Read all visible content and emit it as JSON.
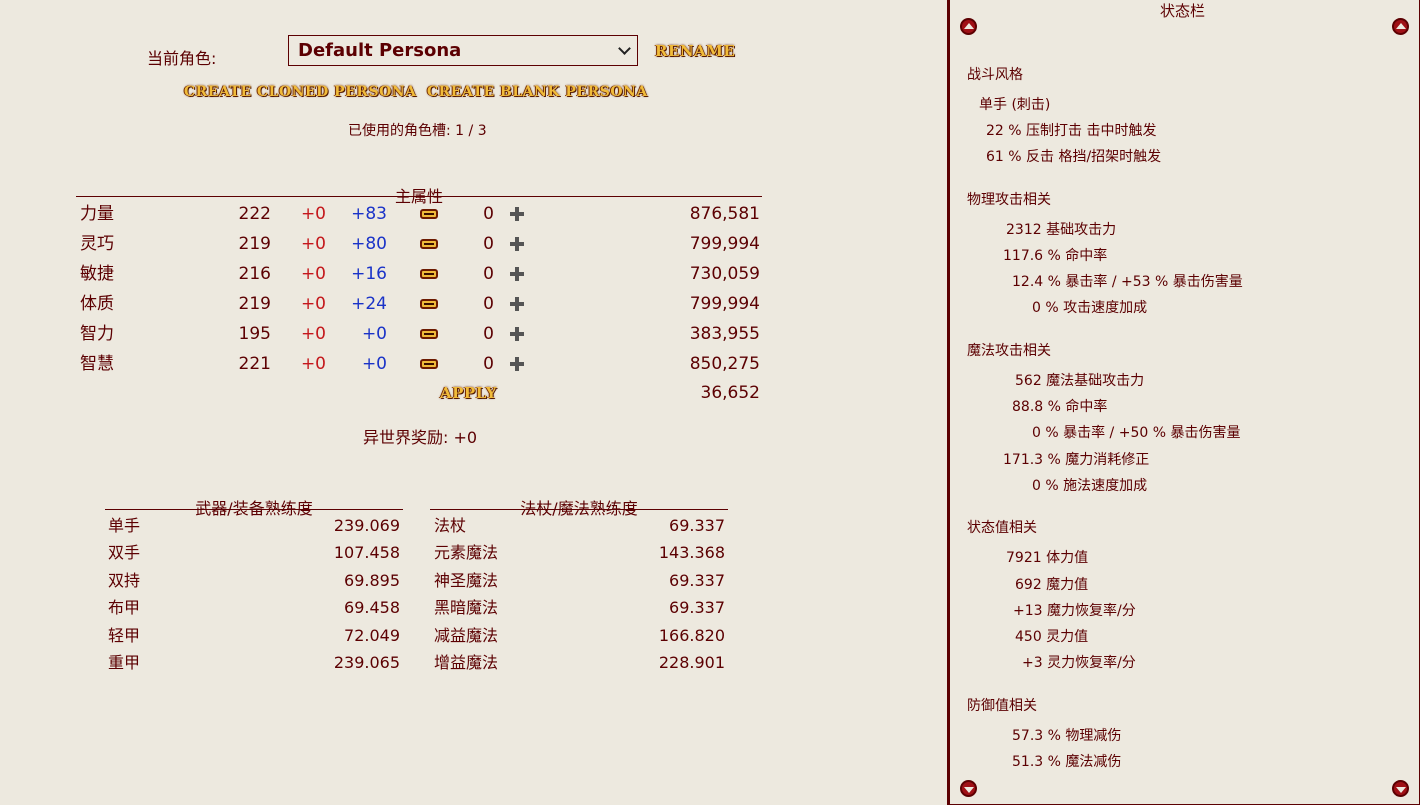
{
  "persona": {
    "label": "当前角色:",
    "selected": "Default Persona",
    "rename_label": "RENAME",
    "clone_label": "CREATE CLONED PERSONA",
    "blank_label": "CREATE BLANK PERSONA",
    "slots_text": "已使用的角色槽: 1 / 3"
  },
  "attributes": {
    "title": "主属性",
    "rows": [
      {
        "name": "力量",
        "base": "222",
        "mod": "+0",
        "bonus": "+83",
        "spent": "0",
        "cost": "876,581"
      },
      {
        "name": "灵巧",
        "base": "219",
        "mod": "+0",
        "bonus": "+80",
        "spent": "0",
        "cost": "799,994"
      },
      {
        "name": "敏捷",
        "base": "216",
        "mod": "+0",
        "bonus": "+16",
        "spent": "0",
        "cost": "730,059"
      },
      {
        "name": "体质",
        "base": "219",
        "mod": "+0",
        "bonus": "+24",
        "spent": "0",
        "cost": "799,994"
      },
      {
        "name": "智力",
        "base": "195",
        "mod": "+0",
        "bonus": "+0",
        "spent": "0",
        "cost": "383,955"
      },
      {
        "name": "智慧",
        "base": "221",
        "mod": "+0",
        "bonus": "+0",
        "spent": "0",
        "cost": "850,275"
      }
    ],
    "apply_label": "APPLY",
    "apply_cost": "36,652",
    "bonus_text": "异世界奖励: +0"
  },
  "weapon_prof": {
    "title": "武器/装备熟练度",
    "rows": [
      {
        "name": "单手",
        "value": "239.069"
      },
      {
        "name": "双手",
        "value": "107.458"
      },
      {
        "name": "双持",
        "value": "69.895"
      },
      {
        "name": "布甲",
        "value": "69.458"
      },
      {
        "name": "轻甲",
        "value": "72.049"
      },
      {
        "name": "重甲",
        "value": "239.065"
      }
    ]
  },
  "magic_prof": {
    "title": "法杖/魔法熟练度",
    "rows": [
      {
        "name": "法杖",
        "value": "69.337"
      },
      {
        "name": "元素魔法",
        "value": "143.368"
      },
      {
        "name": "神圣魔法",
        "value": "69.337"
      },
      {
        "name": "黑暗魔法",
        "value": "69.337"
      },
      {
        "name": "减益魔法",
        "value": "166.820"
      },
      {
        "name": "增益魔法",
        "value": "228.901"
      }
    ]
  },
  "status": {
    "title": "状态栏",
    "fight_style": {
      "head": "战斗风格",
      "style": "单手 (刺击)",
      "l1": "22 % 压制打击 击中时触发",
      "l2": "61 % 反击 格挡/招架时触发"
    },
    "physical": {
      "head": "物理攻击相关",
      "l1": "2312 基础攻击力",
      "l2": "117.6 % 命中率",
      "l3": "12.4 % 暴击率 / +53 % 暴击伤害量",
      "l4": "0 % 攻击速度加成"
    },
    "magical": {
      "head": "魔法攻击相关",
      "l1": "562 魔法基础攻击力",
      "l2": "88.8 % 命中率",
      "l3": "0 % 暴击率 / +50 % 暴击伤害量",
      "l4": "171.3 % 魔力消耗修正",
      "l5": "0 % 施法速度加成"
    },
    "vitals": {
      "head": "状态值相关",
      "l1": "7921 体力值",
      "l2": "692 魔力值",
      "l3": "+13 魔力恢复率/分",
      "l4": "450 灵力值",
      "l5": "+3 灵力恢复率/分"
    },
    "defense": {
      "head": "防御值相关",
      "l1": "57.3 % 物理减伤",
      "l2": "51.3 % 魔法减伤"
    }
  }
}
